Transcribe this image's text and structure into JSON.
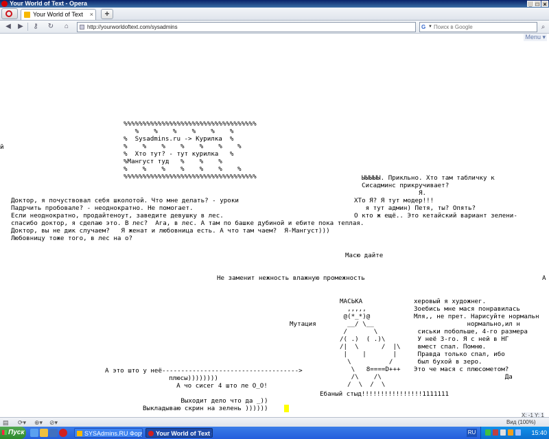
{
  "window": {
    "title": "Your World of Text - Opera"
  },
  "tabs": [
    {
      "label": "Your World of Text",
      "close": "×"
    }
  ],
  "newtab_label": "+",
  "nav": {
    "address": "http://yourworldoftext.com/sysadmins",
    "search_placeholder": "Поиск в Google",
    "search_engine": "G"
  },
  "page": {
    "menu_label": "Menu ▾",
    "coords": "X: -1 Y: 1",
    "text_blocks": [
      {
        "id": "box",
        "text": "%%%%%%%%%%%%%%%%%%%%%%%%%%%%%%%%%%%\n   %    %    %    %    %    %\n%  Sysadmins.ru -> Курилка  %\n%    %    %    %    %    %    %\n%  Хто тут? - тут курилка   %\n%Мангуст туд   %    %    %\n%    %    %    %    %    %    %\n%%%%%%%%%%%%%%%%%%%%%%%%%%%%%%%%%%%"
      },
      {
        "id": "left-edge",
        "text": "й"
      },
      {
        "id": "doctor",
        "text": "Доктор, я почуствовал себя школотой. Что мне делать? - уроки\nПадрчить пробовале? - неоднократно. Не помогает.\nЕсли неоднократно, продайтеноут, заведите девушку в лес.\nспасибо доктор, я сделаю это. В лес?  Ага, в лес. А там по башке дубиной и ебите пока теплая.\nДоктор, вы не дик случаем?   Я женат и любовница есть. А что там чаем?  Я-Мангуст)))\nЛюбовницу тоже того, в лес на о?"
      },
      {
        "id": "table",
        "text": "ЫЫЫЫЫ. Прикльно. Хто там табличку к\nСисадминс прикручивает?\n               Я."
      },
      {
        "id": "moder",
        "text": "ХТо Я? Я тут модер!!!\n   я тут админ) Петя, ты? Опять?\nО кто ж ещё.. Это кетайский вариант зелени-"
      },
      {
        "id": "masya",
        "text": "Масю дайте"
      },
      {
        "id": "nezamenit",
        "text": "Не заменит нежность влажную промежность"
      },
      {
        "id": "right-a",
        "text": "А"
      },
      {
        "id": "ascii-art",
        "text": "МАСЬКА\n  ,,,,,\n @(*_*)@\n  __/ \\__\n /       \\\n/( .)  ( .)\\\n/|  \\      /  |\\\n |    |       |\n  \\          /\n   \\   8====D+++\n   /\\    /\\\n  /  \\  /  \\"
      },
      {
        "id": "mutation",
        "text": "Мутация"
      },
      {
        "id": "xero",
        "text": "херовый я художнег.\nЗоебись мне мася понравилась\nМля,, не прет. Нарисуйте нормальн\n              нормально,ил н\n сиськи побольше, 4-го размера\n У неё 3-го. Я с ней в НГ\n вмест спал. Помню.\n Правда только спал, ибо\n был бухой в зеро.\nЭто че мася с плюсометом?\n                        Да"
      },
      {
        "id": "arrow",
        "text": "А это што у неё------------------------------------>"
      },
      {
        "id": "plusy",
        "text": "плюсы))))))))\n  А чо сисег 4 што ле О_О!"
      },
      {
        "id": "ebany",
        "text": "Ебаный стыд!!!!!!!!!!!!!!!!1111111"
      },
      {
        "id": "vyhodit",
        "text": "          Выходит дело что да _))\nВыкладываю скрин на зелень ))))))"
      }
    ]
  },
  "statusbar": {
    "zoom": "Вид (100%)"
  },
  "taskbar": {
    "start": "Пуск",
    "tasks": [
      {
        "label": "SYSAdmins.RU Форум - ..."
      },
      {
        "label": "Your World of Text - ..."
      }
    ],
    "lang": "RU",
    "clock": "15:40"
  }
}
